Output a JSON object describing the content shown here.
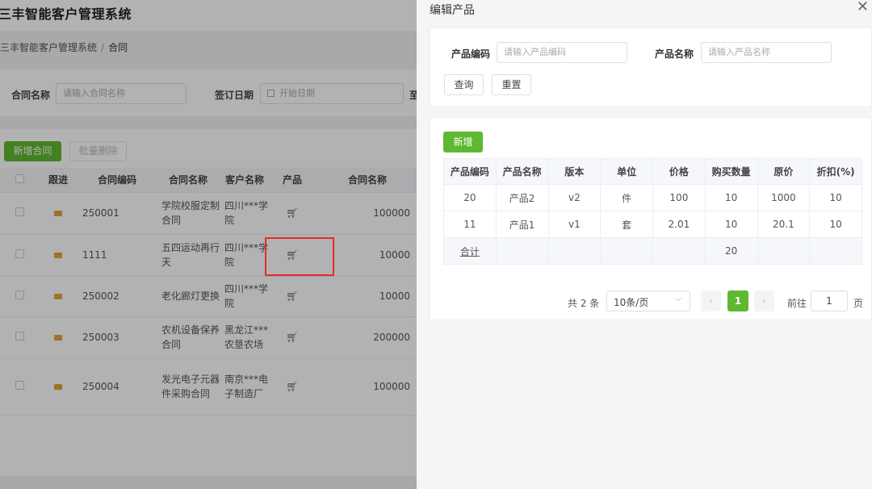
{
  "app": {
    "title": "三丰智能客户管理系统",
    "breadcrumb": [
      "三丰智能客户管理系统",
      "合同"
    ]
  },
  "search": {
    "contract_name_label": "合同名称",
    "contract_name_placeholder": "请输入合同名称",
    "sign_date_label": "签订日期",
    "start_date_placeholder": "开始日期",
    "range_to": "至"
  },
  "toolbar": {
    "add_contract": "新增合同",
    "batch_delete": "批量删除"
  },
  "contract_table": {
    "headers": [
      "跟进",
      "合同编码",
      "合同名称",
      "客户名称",
      "产品",
      "合同名称"
    ],
    "rows": [
      {
        "code": "250001",
        "name": "学院校服定制合同",
        "customer": "四川***学院",
        "amount": "100000"
      },
      {
        "code": "1111",
        "name": "五四运动再行天",
        "customer": "四川***学院",
        "amount": "10000"
      },
      {
        "code": "250002",
        "name": "老化廊灯更换",
        "customer": "四川***学院",
        "amount": "10000"
      },
      {
        "code": "250003",
        "name": "农机设备保养合同",
        "customer": "黑龙江***农垦农场",
        "amount": "200000"
      },
      {
        "code": "250004",
        "name": "发光电子元器件采购合同",
        "customer": "南京***电子制造厂",
        "amount": "100000"
      }
    ]
  },
  "drawer": {
    "title": "编辑产品",
    "product_code_label": "产品编码",
    "product_code_placeholder": "请输入产品编码",
    "product_name_label": "产品名称",
    "product_name_placeholder": "请输入产品名称",
    "query_button": "查询",
    "reset_button": "重置",
    "add_button": "新增",
    "table": {
      "headers": [
        "产品编码",
        "产品名称",
        "版本",
        "单位",
        "价格",
        "购买数量",
        "原价",
        "折扣(%)"
      ],
      "rows": [
        [
          "20",
          "产品2",
          "v2",
          "件",
          "100",
          "10",
          "1000",
          "10"
        ],
        [
          "11",
          "产品1",
          "v1",
          "套",
          "2.01",
          "10",
          "20.1",
          "10"
        ]
      ],
      "summary_label": "合计",
      "summary_quantity": "20"
    },
    "pagination": {
      "total": "共 2 条",
      "page_size": "10条/页",
      "current_page": "1",
      "goto_label": "前往",
      "goto_value": "1",
      "page_suffix": "页"
    }
  }
}
